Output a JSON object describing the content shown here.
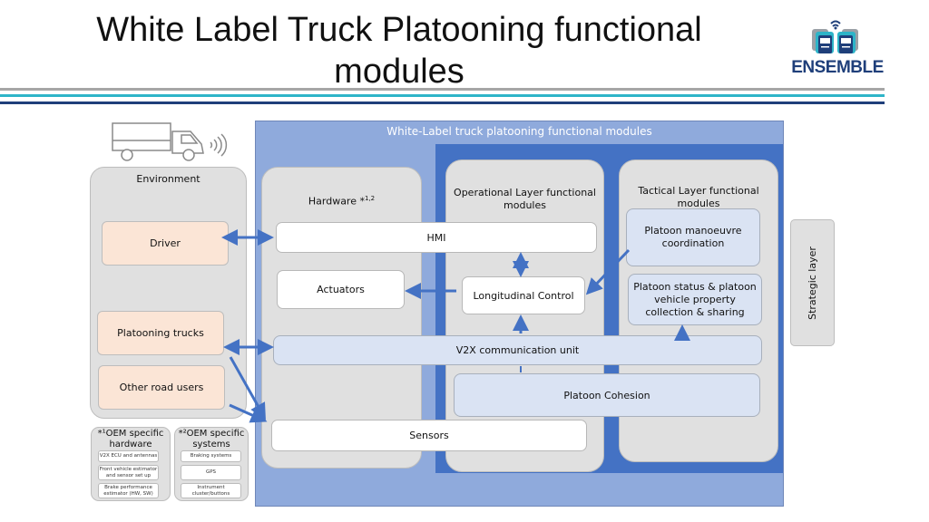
{
  "header": {
    "title": "White Label Truck Platooning functional modules",
    "logo_text": "ENSEMBLE",
    "logo_icon": "trucks-wifi-icon"
  },
  "colors": {
    "outer_frame": "#8faadc",
    "inner_frame": "#4472c4",
    "arrow": "#4472c4",
    "grey_panel": "#e0e0e0",
    "peach": "#fbe5d6",
    "light_blue": "#dae3f3",
    "logo_blue": "#1f3f7a",
    "rule_grey": "#a6a6a6",
    "rule_teal": "#2eb4c8",
    "rule_navy": "#1f3f7a"
  },
  "diagram": {
    "frame_title": "White-Label truck platooning functional modules",
    "environment": {
      "title": "Environment",
      "items": [
        "Driver",
        "Platooning trucks",
        "Other road users"
      ]
    },
    "oem_hardware": {
      "title": "*¹OEM specific hardware",
      "items": [
        "V2X ECU and antennas",
        "Front vehicle estimator and sensor set up",
        "Brake performance estimator (HW, SW)"
      ]
    },
    "oem_systems": {
      "title": "*²OEM specific systems",
      "items": [
        "Braking systems",
        "GPS",
        "Instrument cluster/buttons"
      ]
    },
    "hardware": {
      "title": "Hardware *",
      "title_sup": "1,2"
    },
    "operational": {
      "title": "Operational Layer functional modules"
    },
    "tactical": {
      "title": "Tactical Layer functional modules"
    },
    "modules": {
      "hmi": "HMI",
      "actuators": "Actuators",
      "longitudinal_control": "Longitudinal Control",
      "platoon_manoeuvre": "Platoon manoeuvre coordination",
      "platoon_status": "Platoon status & platoon vehicle property collection & sharing",
      "v2x": "V2X communication unit",
      "platoon_cohesion": "Platoon Cohesion",
      "sensors": "Sensors"
    },
    "strategic_layer": "Strategic layer"
  }
}
